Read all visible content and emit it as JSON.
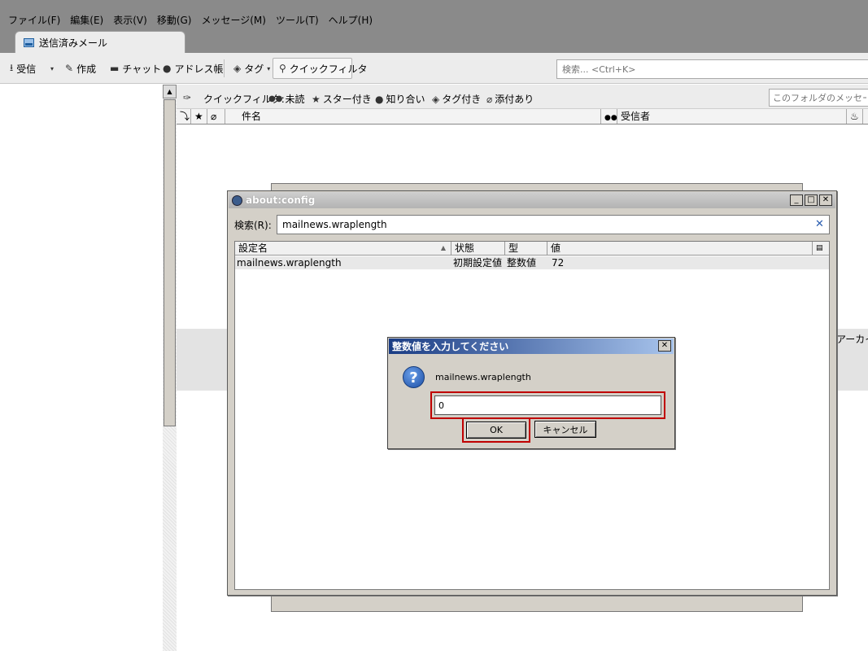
{
  "menubar": {
    "items": [
      "ファイル(F)",
      "編集(E)",
      "表示(V)",
      "移動(G)",
      "メッセージ(M)",
      "ツール(T)",
      "ヘルプ(H)"
    ]
  },
  "tab": {
    "label": "送信済みメール"
  },
  "toolbar": {
    "get_mail": "受信",
    "write": "作成",
    "chat": "チャット",
    "address_book": "アドレス帳",
    "tag": "タグ",
    "quick_filter": "クイックフィルタ",
    "search_placeholder": "検索... <Ctrl+K>"
  },
  "quickfilter": {
    "label": "クイックフィルタ:",
    "unread": "未読",
    "starred": "スター付き",
    "contact": "知り合い",
    "tags": "タグ付き",
    "attachment": "添付あり",
    "search_placeholder": "このフォルダのメッセージを"
  },
  "thread_columns": {
    "subject": "件名",
    "recipient": "受信者"
  },
  "background": {
    "archive_text": "アーカイ"
  },
  "aboutconfig": {
    "title": "about:config",
    "search_label": "検索(R):",
    "search_value": "mailnews.wraplength",
    "columns": [
      "設定名",
      "状態",
      "型",
      "値"
    ],
    "row": {
      "name": "mailnews.wraplength",
      "status": "初期設定値",
      "type": "整数値",
      "value": "72"
    }
  },
  "prompt": {
    "title": "整数値を入力してください",
    "message": "mailnews.wraplength",
    "input_value": "0",
    "ok_label": "OK",
    "cancel_label": "キャンセル"
  },
  "colors": {
    "highlight_frame": "#c00000",
    "prompt_title_start": "#1a3c84",
    "prompt_title_end": "#a8c4ec"
  }
}
